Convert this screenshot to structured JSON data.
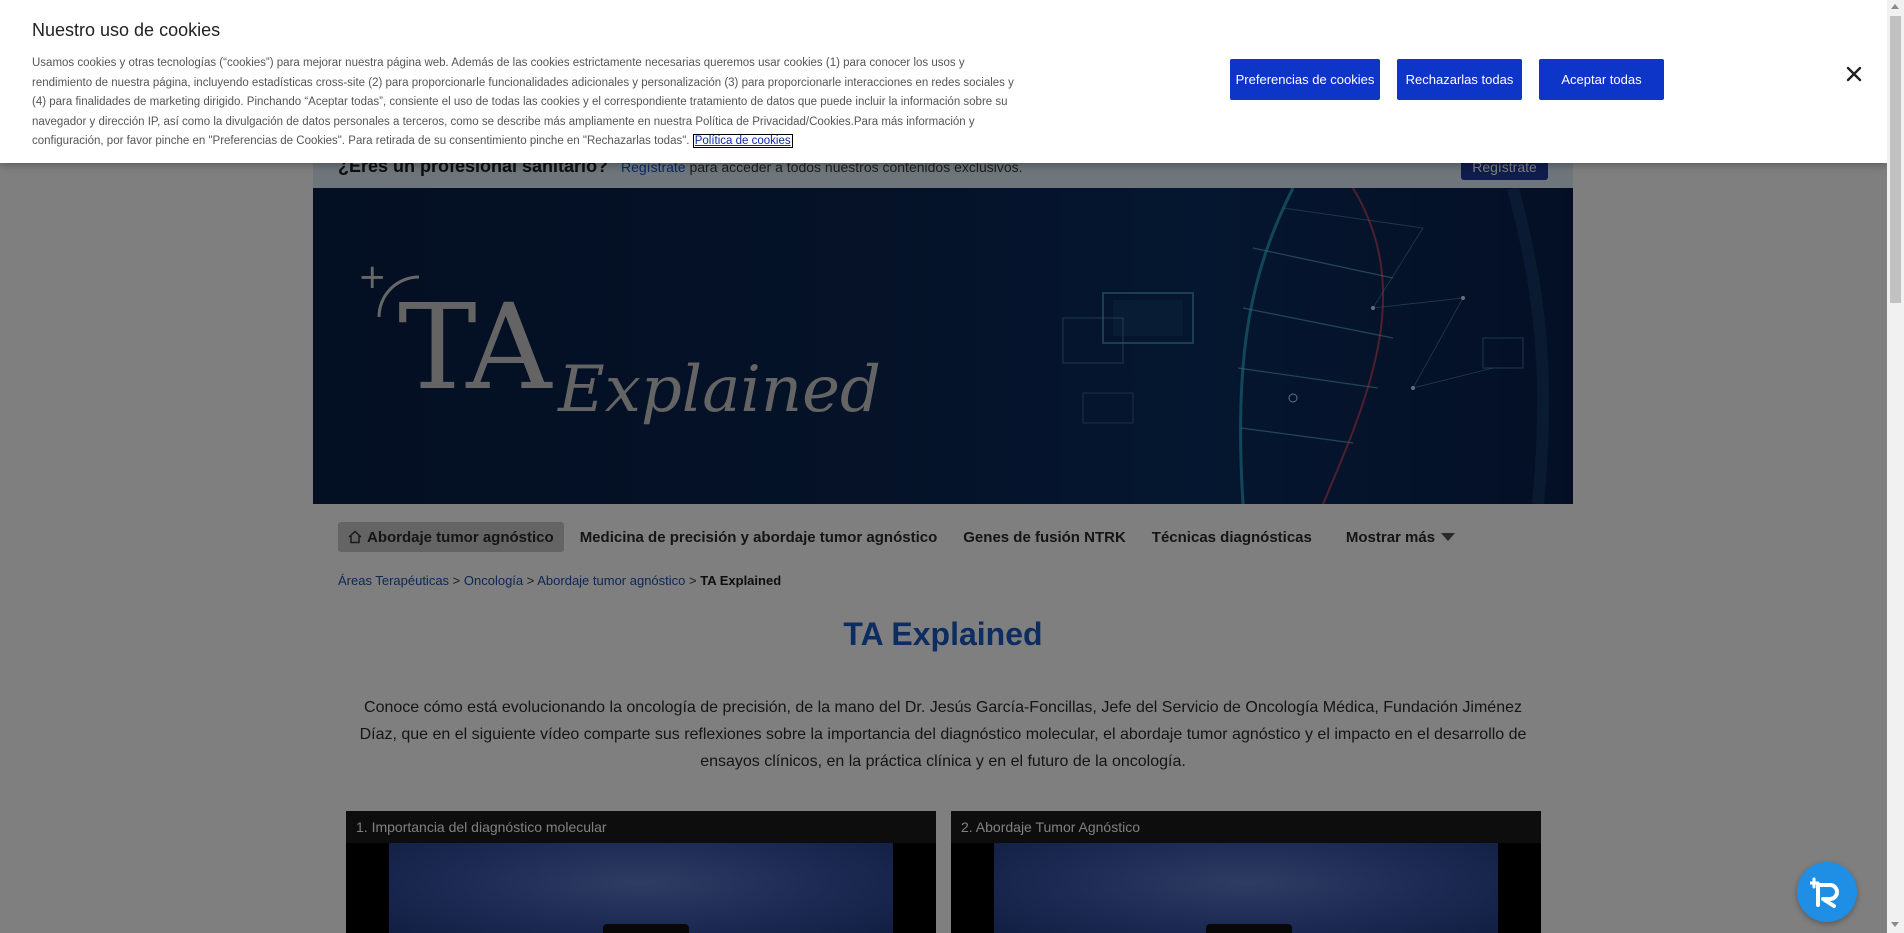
{
  "pro_bar": {
    "question": "¿Eres un profesional sanitario?",
    "register_link": "Regístrate",
    "message": " para acceder a todos nuestros contenidos exclusivos.",
    "register_button": "Regístrate"
  },
  "banner": {
    "plus": "+",
    "ta": "TA",
    "explained": "Explained"
  },
  "nav": {
    "items": [
      {
        "label": "Abordaje tumor agnóstico",
        "active": true
      },
      {
        "label": "Medicina de precisión y abordaje tumor agnóstico"
      },
      {
        "label": "Genes de fusión NTRK"
      },
      {
        "label": "Técnicas diagnósticas"
      },
      {
        "label": "Mostrar más"
      }
    ]
  },
  "breadcrumb": {
    "items": [
      "Áreas Terapéuticas",
      "Oncología",
      "Abordaje tumor agnóstico"
    ],
    "separator": " > ",
    "current": "TA Explained"
  },
  "page": {
    "title": "TA Explained",
    "intro": "Conoce cómo está evolucionando la oncología de precisión, de la mano del Dr. Jesús García-Foncillas, Jefe del Servicio de Oncología Médica, Fundación Jiménez Díaz, que en el siguiente vídeo comparte sus reflexiones sobre la importancia del diagnóstico molecular, el abordaje tumor agnóstico y el impacto en el desarrollo de ensayos clínicos, en la práctica clínica y en el futuro de la oncología."
  },
  "videos": [
    {
      "caption": "1. Importancia del diagnóstico molecular"
    },
    {
      "caption": "2. Abordaje Tumor Agnóstico"
    }
  ],
  "cookie": {
    "title": "Nuestro uso de cookies",
    "body": "Usamos cookies y otras tecnologías (“cookies”) para mejorar nuestra página web. Además de las cookies estrictamente necesarias queremos usar cookies (1) para conocer los usos y rendimiento de nuestra página, incluyendo estadísticas cross-site (2) para proporcionarle funcionalidades adicionales y personalización (3) para proporcionarle interacciones en redes sociales y (4) para finalidades de marketing dirigido. Pinchando “Aceptar todas”, consiente el uso de todas las cookies y el correspondiente tratamiento de datos que puede incluir la información sobre su navegador y dirección IP, así como la divulgación de datos personales a terceros, como se describe más ampliamente en nuestra Política de Privacidad/Cookies.Para más información y configuración, por favor pinche en \"Preferencias de Cookies\". Para retirada de su consentimiento pinche en \"Rechazarlas todas\". ",
    "policy_link": "Política de cookies",
    "buttons": {
      "preferences": "Preferencias de cookies",
      "reject": "Rechazarlas todas",
      "accept": "Aceptar todas"
    }
  },
  "colors": {
    "accent_blue": "#0d35c7",
    "title_blue": "#1a5bc4",
    "banner_navy": "#0a2551",
    "fab_blue": "#1f8fe6"
  },
  "icons": {
    "home": "home-icon",
    "caret": "caret-down-icon",
    "close": "close-icon",
    "fab": "assistant-logo-icon"
  }
}
